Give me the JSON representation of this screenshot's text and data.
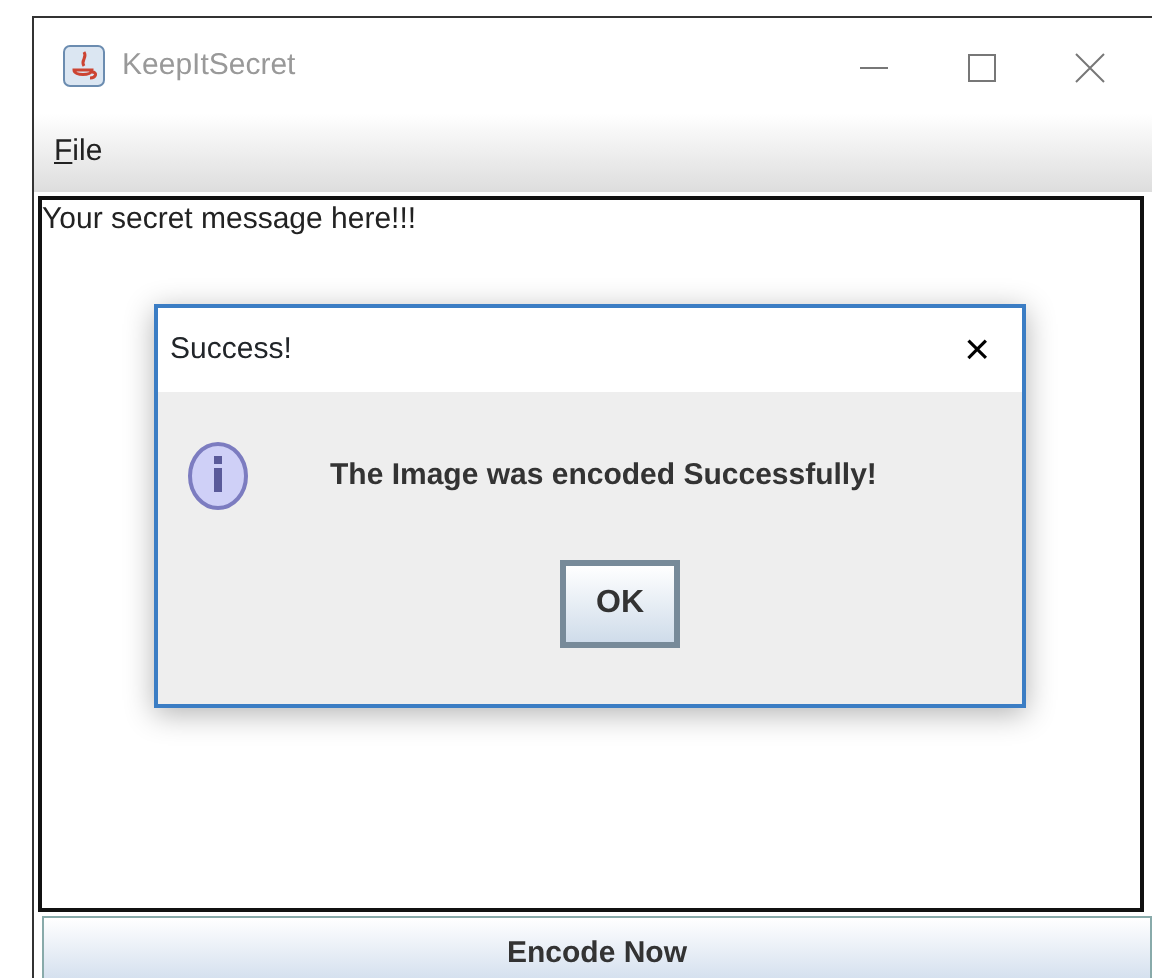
{
  "window": {
    "title": "KeepItSecret"
  },
  "menu": [
    {
      "label": "File",
      "mnemonic_underlined": true
    }
  ],
  "message_area": {
    "value": "Your secret message here!!!"
  },
  "dialog": {
    "title": "Success!",
    "close": "×",
    "message": "The Image was encoded Successfully!",
    "button": "OK"
  },
  "encode_button": {
    "label": "Encode Now"
  }
}
